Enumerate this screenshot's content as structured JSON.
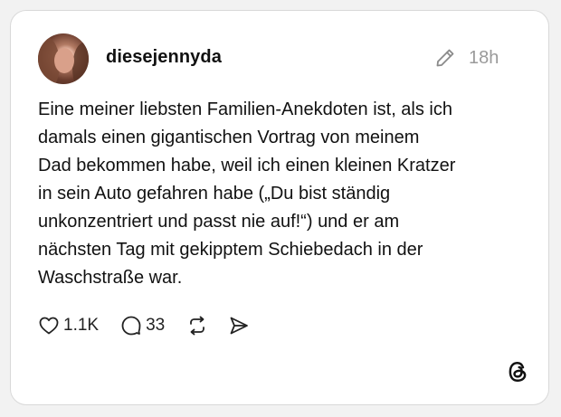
{
  "post": {
    "username": "diesejennyda",
    "time": "18h",
    "text": "Eine meiner liebsten Familien-Anekdoten ist, als ich\ndamals einen gigantischen Vortrag von meinem\nDad bekommen habe, weil ich einen kleinen Kratzer\nin sein Auto gefahren habe („Du bist ständig\nunkonzentriert und passt nie auf!“) und er am\nnächsten Tag mit gekipptem Schiebedach in der\nWaschstraße war.",
    "likes": "1.1K",
    "comments": "33"
  },
  "icons": {
    "edit": "pencil-icon",
    "like": "heart-icon",
    "comment": "comment-icon",
    "repost": "repost-icon",
    "share": "send-icon",
    "brand": "threads-logo"
  },
  "colors": {
    "text": "#111111",
    "muted": "#9a9a9a",
    "border": "#d9d9d9"
  }
}
